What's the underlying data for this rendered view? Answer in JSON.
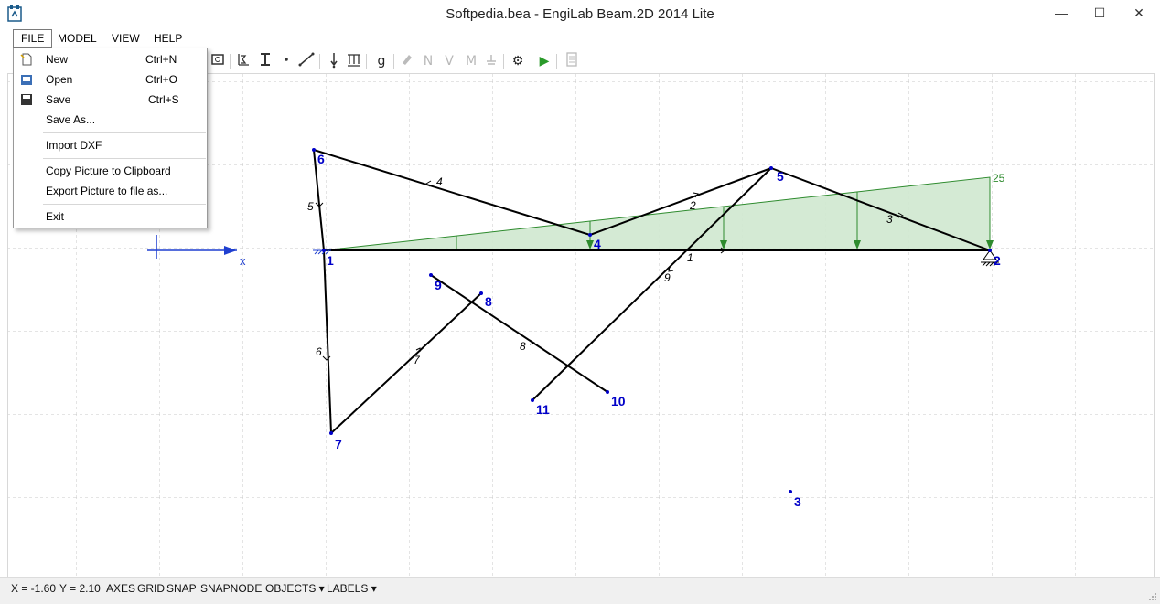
{
  "window": {
    "title": "Softpedia.bea - EngiLab Beam.2D 2014 Lite",
    "minimize_glyph": "—",
    "maximize_glyph": "☐",
    "close_glyph": "✕"
  },
  "menubar": {
    "items": [
      "FILE",
      "MODEL",
      "VIEW",
      "HELP"
    ],
    "active": "FILE"
  },
  "file_menu": {
    "items": [
      {
        "label": "New",
        "shortcut": "Ctrl+N",
        "icon": "new-file-icon"
      },
      {
        "label": "Open",
        "shortcut": "Ctrl+O",
        "icon": "open-folder-icon"
      },
      {
        "label": "Save",
        "shortcut": "Ctrl+S",
        "icon": "save-disk-icon"
      },
      {
        "label": "Save As...",
        "shortcut": "",
        "icon": ""
      },
      {
        "label": "Import DXF",
        "shortcut": "",
        "icon": ""
      },
      {
        "label": "Copy Picture to Clipboard",
        "shortcut": "",
        "icon": ""
      },
      {
        "label": "Export Picture to file as...",
        "shortcut": "",
        "icon": ""
      },
      {
        "label": "Exit",
        "shortcut": "",
        "icon": ""
      }
    ]
  },
  "toolbar": {
    "icons": [
      "section-icon",
      "material-icon",
      "ibeam-icon",
      "node-icon",
      "element-icon",
      "point-load-icon",
      "distributed-load-icon",
      "gravity-icon",
      "eraser-icon",
      "axial-force-icon",
      "shear-force-icon",
      "moment-icon",
      "support-icon",
      "settings-gear-icon",
      "run-analysis-icon",
      "report-icon"
    ],
    "glyphs": {
      "gravity": "g",
      "axial": "N",
      "shear": "V",
      "moment": "M",
      "gear": "⚙",
      "run": "▶"
    }
  },
  "canvas": {
    "axis_x_label": "x",
    "load_value": "25",
    "node_labels": [
      "1",
      "2",
      "3",
      "4",
      "5",
      "6",
      "7",
      "8",
      "9",
      "10",
      "11"
    ],
    "element_labels": [
      "1",
      "2",
      "3",
      "4",
      "5",
      "6",
      "7",
      "8",
      "9"
    ],
    "colors": {
      "member": "#000000",
      "node_label": "#0000c8",
      "load_fill": "#cfe8cf",
      "load_line": "#2e8b2e",
      "axis": "#1f3fd0",
      "grid": "#c8c8c8"
    }
  },
  "statusbar": {
    "x_readout": "X = -1.60",
    "y_readout": "Y = 2.10",
    "toggles": [
      "AXES",
      "GRID",
      "SNAP",
      "SNAPNODE"
    ],
    "objects_dropdown": "OBJECTS ▾",
    "labels_dropdown": "LABELS ▾"
  }
}
